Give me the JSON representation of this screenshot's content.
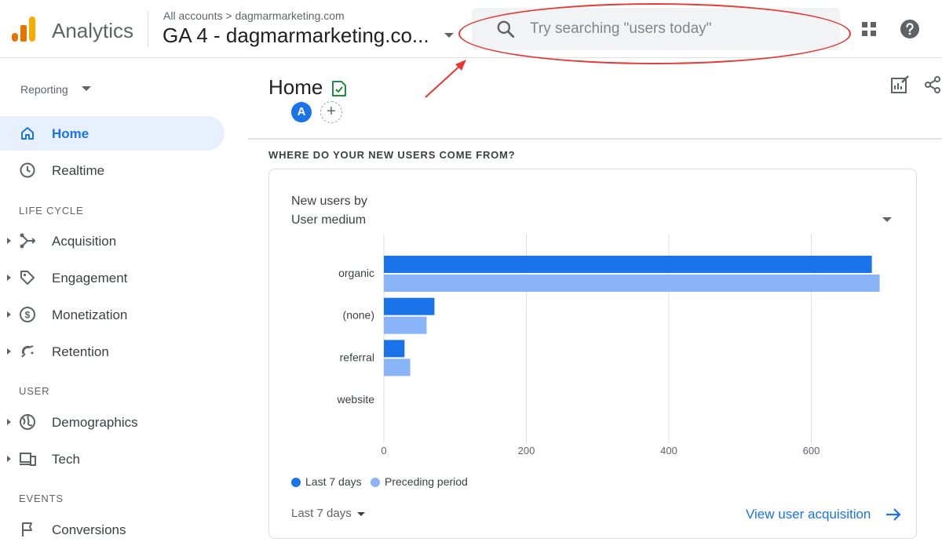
{
  "header": {
    "brand": "Analytics",
    "breadcrumb": "All accounts > dagmarmarketing.com",
    "account_name": "GA 4 - dagmarmarketing.co...",
    "search_placeholder": "Try searching \"users today\""
  },
  "sidebar": {
    "reporting_label": "Reporting",
    "items": [
      {
        "label": "Home",
        "icon": "home-icon",
        "active": true
      },
      {
        "label": "Realtime",
        "icon": "clock-icon"
      },
      {
        "label": "Acquisition",
        "icon": "acquisition-icon"
      },
      {
        "label": "Engagement",
        "icon": "tag-icon"
      },
      {
        "label": "Monetization",
        "icon": "dollar-icon"
      },
      {
        "label": "Retention",
        "icon": "retention-icon"
      },
      {
        "label": "Demographics",
        "icon": "globe-icon"
      },
      {
        "label": "Tech",
        "icon": "devices-icon"
      },
      {
        "label": "Conversions",
        "icon": "flag-icon"
      }
    ],
    "sections": {
      "life_cycle": "LIFE CYCLE",
      "user": "USER",
      "events": "EVENTS"
    }
  },
  "main": {
    "title": "Home",
    "avatar_letter": "A",
    "add_compare": "+",
    "question": "WHERE DO YOUR NEW USERS COME FROM?",
    "card": {
      "title_line1": "New users by",
      "title_line2": "User medium",
      "range_label": "Last 7 days",
      "view_link": "View user acquisition"
    }
  },
  "colors": {
    "accent": "#1a73e8",
    "current_bar": "#1a73e8",
    "previous_bar": "#8ab4f8",
    "annotation": "#e53935"
  },
  "chart_data": {
    "type": "bar",
    "orientation": "horizontal",
    "categories": [
      "organic",
      "(none)",
      "referral",
      "website"
    ],
    "series": [
      {
        "name": "Last 7 days",
        "values": [
          685,
          71,
          29,
          0
        ]
      },
      {
        "name": "Preceding period",
        "values": [
          696,
          60,
          37,
          0
        ]
      }
    ],
    "xticks": [
      0,
      200,
      400,
      600
    ],
    "xlim": [
      0,
      720
    ],
    "grid": true,
    "legend": "bottom-left"
  }
}
